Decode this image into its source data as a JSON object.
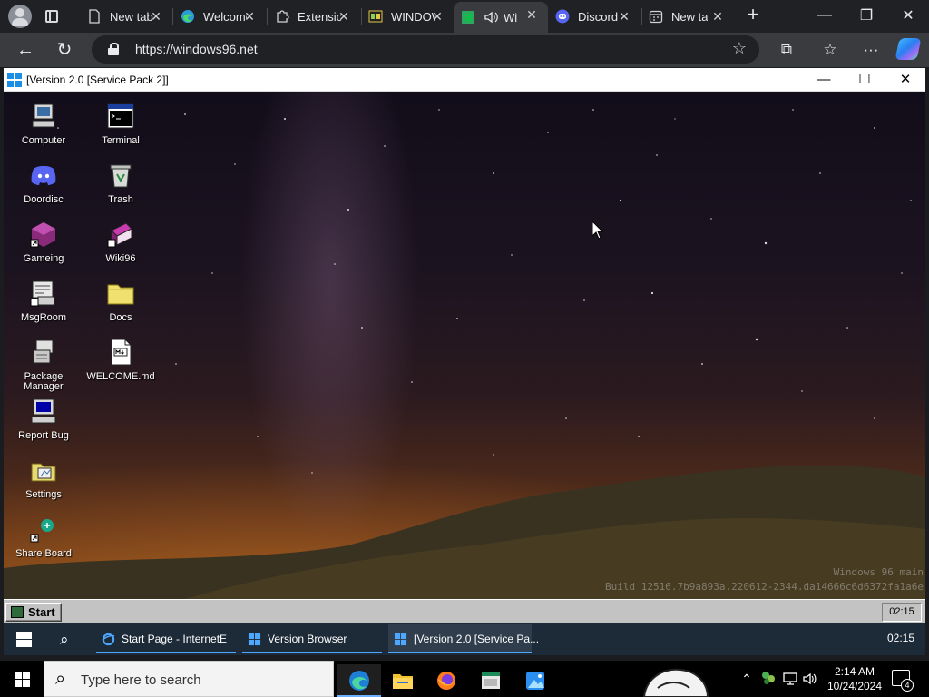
{
  "browser": {
    "tabs": [
      {
        "label": "New tab",
        "icon": "page-icon",
        "active": false
      },
      {
        "label": "Welcome",
        "icon": "edge-icon",
        "active": false
      },
      {
        "label": "Extensions",
        "icon": "puzzle-icon",
        "active": false
      },
      {
        "label": "WINDOWS",
        "icon": "app-icon",
        "active": false
      },
      {
        "label": "Wi",
        "icon": "windows96-icon",
        "active": true
      },
      {
        "label": "Discord",
        "icon": "discord-icon",
        "active": false
      },
      {
        "label": "New tab",
        "icon": "calendar-icon",
        "active": false
      }
    ],
    "url": "https://windows96.net"
  },
  "w96_window": {
    "title": "[Version 2.0 [Service Pack 2]]"
  },
  "desktop_icons": [
    {
      "label": "Computer",
      "icon": "computer-icon"
    },
    {
      "label": "Terminal",
      "icon": "terminal-icon"
    },
    {
      "label": "Doordisc",
      "icon": "doordisc-icon"
    },
    {
      "label": "Trash",
      "icon": "trash-icon"
    },
    {
      "label": "Gameing",
      "icon": "gameing-icon"
    },
    {
      "label": "Wiki96",
      "icon": "wiki96-icon"
    },
    {
      "label": "MsgRoom",
      "icon": "msgroom-icon"
    },
    {
      "label": "Docs",
      "icon": "folder-icon"
    },
    {
      "label": "Package Manager",
      "icon": "package-manager-icon"
    },
    {
      "label": "WELCOME.md",
      "icon": "markdown-file-icon"
    },
    {
      "label": "Report Bug",
      "icon": "report-bug-icon"
    },
    {
      "label": "Settings",
      "icon": "settings-icon"
    },
    {
      "label": "Share Board",
      "icon": "share-board-icon"
    }
  ],
  "watermark": {
    "line1": "Windows 96 main",
    "line2": "Build 12516.7b9a893a.220612-2344.da14666c6d6372fa1a6e"
  },
  "w96_taskbar": {
    "start_label": "Start",
    "clock": "02:15"
  },
  "vm_taskbar": {
    "tasks": [
      "Start Page - InternetE",
      "Version Browser",
      "[Version 2.0 [Service Pa..."
    ],
    "clock": "02:15"
  },
  "host_taskbar": {
    "search_placeholder": "Type here to search",
    "time": "2:14 AM",
    "date": "10/24/2024",
    "notification_count": "4"
  },
  "colors": {
    "w96_accent": "#1a8fe3",
    "host_taskbar": "#000000",
    "vm_taskbar": "#1d2a38"
  }
}
